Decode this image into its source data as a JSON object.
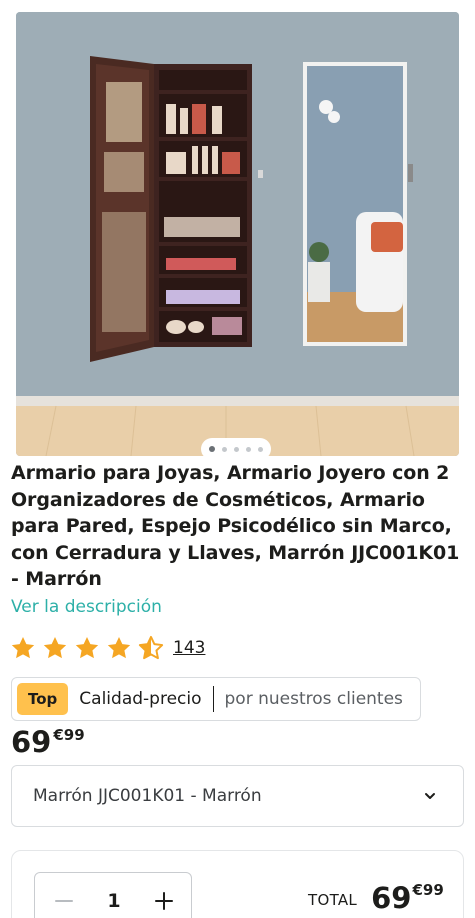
{
  "product": {
    "title": "Armario para Joyas, Armario Joyero con 2 Organizadores de Cosméticos, Armario para Pared, Espejo Psicodélico sin Marco, con Cerradura y Llaves, Marrón JJC001K01 - Marrón",
    "description_link": "Ver la descripción",
    "image_alt_icon": "jewelry-cabinet-photo"
  },
  "gallery": {
    "total_images": 6,
    "active_index": 0
  },
  "rating": {
    "stars": 4.5,
    "max_stars": 5,
    "count": "143",
    "star_color": "#f5a623"
  },
  "badge": {
    "tag": "Top",
    "main": "Calidad-precio",
    "sub": "por nuestros clientes",
    "tag_color": "#ffc14d"
  },
  "price": {
    "integer": "69",
    "decimals": "€99"
  },
  "variant_select": {
    "value": "Marrón JJC001K01 - Marrón"
  },
  "purchase": {
    "quantity": "1",
    "total_label": "TOTAL",
    "total_integer": "69",
    "total_decimals": "€99"
  },
  "colors": {
    "link": "#2db0a8",
    "text": "#1d1d1b"
  }
}
